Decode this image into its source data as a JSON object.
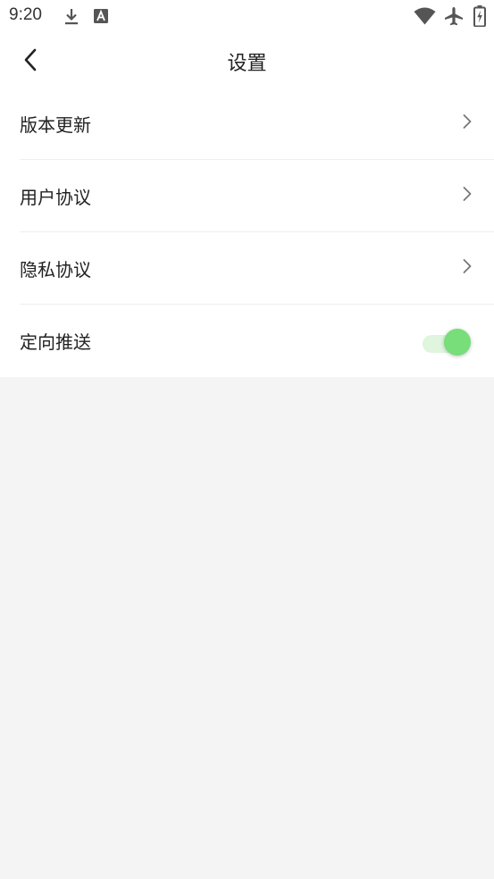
{
  "status_bar": {
    "time": "9:20",
    "icons": [
      "download-icon",
      "a-notification-icon",
      "wifi-icon",
      "airplane-mode-icon",
      "battery-charging-icon"
    ]
  },
  "header": {
    "title": "设置",
    "back_icon": "chevron-left-icon"
  },
  "settings": {
    "items": [
      {
        "label": "版本更新",
        "type": "link"
      },
      {
        "label": "用户协议",
        "type": "link"
      },
      {
        "label": "隐私协议",
        "type": "link"
      },
      {
        "label": "定向推送",
        "type": "toggle",
        "value": true
      }
    ]
  },
  "colors": {
    "background": "#f4f4f4",
    "surface": "#ffffff",
    "toggle_on": "#77de7a",
    "toggle_track": "#dff5dd"
  }
}
